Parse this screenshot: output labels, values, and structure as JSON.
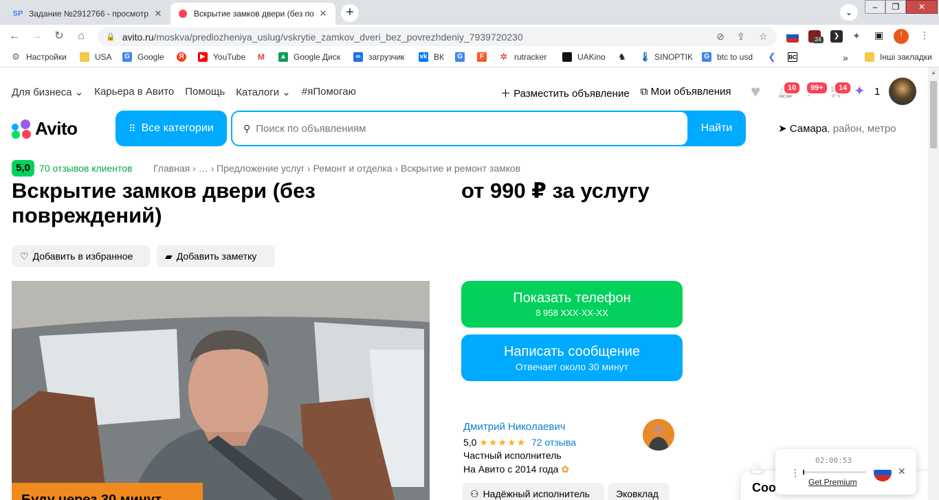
{
  "browser": {
    "tabs": [
      {
        "title": "Задание №2912766 - просмотр",
        "favicon": "SP",
        "active": false
      },
      {
        "title": "Вскрытие замков двери (без по",
        "favicon": "",
        "active": true
      }
    ],
    "new_tab": "+",
    "url_host": "avito.ru",
    "url_path": "/moskva/predlozheniya_uslug/vskrytie_zamkov_dveri_bez_povrezhdeniy_7939720230",
    "ext_badge": "24",
    "bookmarks": [
      "Настройки",
      "USA",
      "Google",
      "",
      "YouTube",
      "",
      "Google Диск",
      "загрузчик",
      "ВК",
      "",
      "",
      "rutracker",
      "UAKino",
      "",
      "SINOPTIK",
      "btc to usd",
      "",
      ""
    ],
    "bookmarks_more": "»",
    "other_bookmarks": "Інші закладки"
  },
  "header": {
    "nav": [
      "Для бизнеса",
      "Карьера в Авито",
      "Помощь",
      "Каталоги",
      "#яПомогаю"
    ],
    "post_ad": "Разместить объявление",
    "my_ads": "Мои объявления",
    "badges": {
      "notifications": "10",
      "messages": "99+",
      "cart": "14"
    },
    "tickets": "1",
    "logo": "Avito",
    "all_categories": "Все категории",
    "search_placeholder": "Поиск по объявлениям",
    "search_button": "Найти",
    "location_city": "Самара",
    "location_rest": ", район, метро"
  },
  "listing": {
    "rating": "5,0",
    "reviews_link": "70 отзывов клиентов",
    "breadcrumbs": "Главная › … › Предложение услуг › Ремонт и отделка › Вскрытие и ремонт замков",
    "title": "Вскрытие замков двери (без повреждений)",
    "price": "от 990 ₽ за услугу",
    "add_favorite": "Добавить в избранное",
    "add_note": "Добавить заметку",
    "photo_banner": "Буду через 30 минут"
  },
  "contact": {
    "show_phone": "Показать телефон",
    "phone_masked": "8 958 XXX-XX-XX",
    "write_message": "Написать сообщение",
    "reply_time": "Отвечает около 30 минут"
  },
  "seller": {
    "name": "Дмитрий Николаевич",
    "rating": "5,0",
    "stars": "★★★★★",
    "reviews": "72 отзыва",
    "type": "Частный исполнитель",
    "since": "На Авито с 2014 года",
    "tags": [
      "Надёжный исполнитель",
      "Эковклад"
    ]
  },
  "cookie_card": {
    "text": "Coo"
  },
  "recorder": {
    "time": "02:00:53",
    "premium": "Get Premium"
  },
  "colors": {
    "avito_blue": "#00aaff",
    "avito_green": "#02d15c",
    "link_blue": "#0a82cd",
    "badge_red": "#ff4053"
  }
}
